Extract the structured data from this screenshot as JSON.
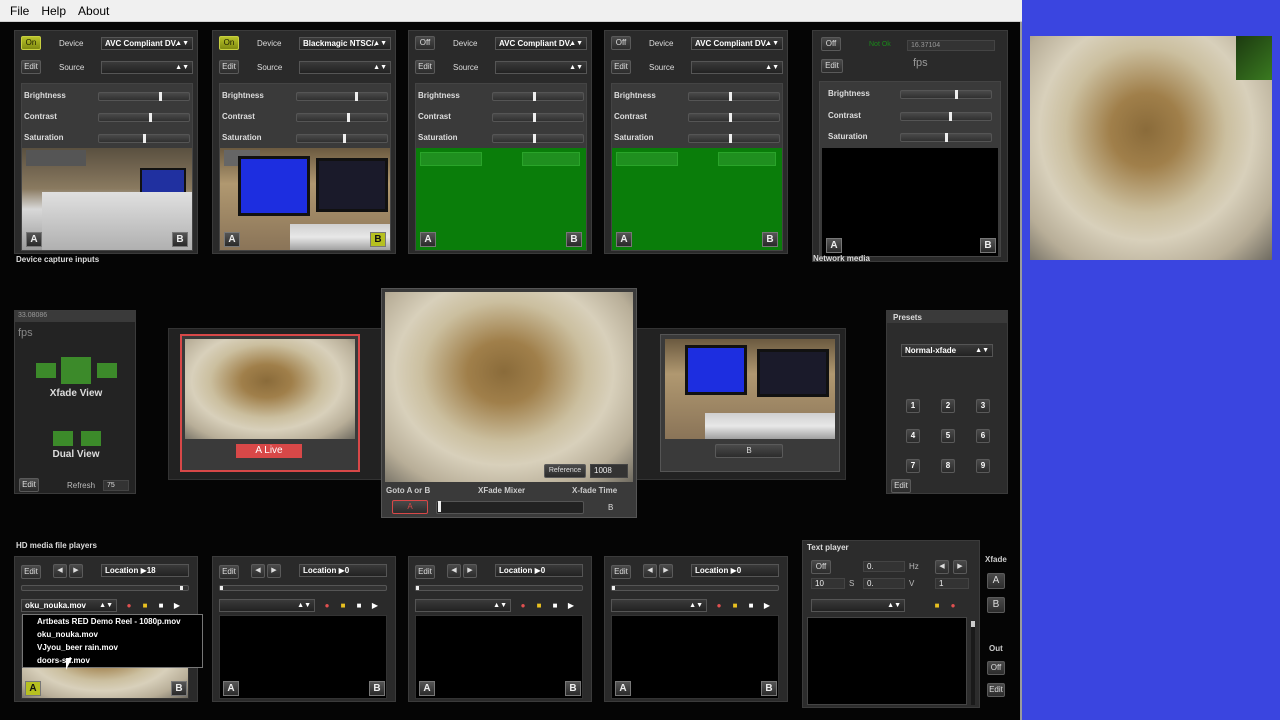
{
  "menu": {
    "file": "File",
    "help": "Help",
    "about": "About"
  },
  "labels": {
    "on": "On",
    "off": "Off",
    "edit": "Edit",
    "device": "Device",
    "source": "Source",
    "brightness": "Brightness",
    "contrast": "Contrast",
    "saturation": "Saturation",
    "a": "A",
    "b": "B",
    "fps": "fps"
  },
  "capture": {
    "section_label": "Device capture inputs",
    "channels": [
      {
        "state": "On",
        "device": "AVC Compliant DV.",
        "b_active": false
      },
      {
        "state": "On",
        "device": "Blackmagic NTSC/.",
        "b_active": true
      },
      {
        "state": "Off",
        "device": "AVC Compliant DV.",
        "b_active": false
      },
      {
        "state": "Off",
        "device": "AVC Compliant DV.",
        "b_active": false
      }
    ]
  },
  "network": {
    "section_label": "Network media",
    "state": "Off",
    "status": "Not Ok",
    "fps_value": "16.37104",
    "fps_label": "fps"
  },
  "xfade_panel": {
    "fps_value": "33.08086",
    "fps_label": "fps",
    "xfade_view": "Xfade View",
    "dual_view": "Dual View",
    "refresh_label": "Refresh",
    "refresh_value": "75"
  },
  "mixer": {
    "a_live": "A Live",
    "b_label": "B",
    "reference": "Reference",
    "time_value": "1008",
    "goto_label": "Goto A or B",
    "mixer_label": "XFade Mixer",
    "time_label": "X-fade Time",
    "position": 0.01
  },
  "presets": {
    "title": "Presets",
    "mode": "Normal-xfade",
    "buttons": [
      "1",
      "2",
      "3",
      "4",
      "5",
      "6",
      "7",
      "8",
      "9"
    ]
  },
  "media": {
    "section_label": "HD media file players",
    "players": [
      {
        "location": "Location",
        "location_value": "18",
        "file": "oku_nouka.mov"
      },
      {
        "location": "Location",
        "location_value": "0",
        "file": ""
      },
      {
        "location": "Location",
        "location_value": "0",
        "file": ""
      },
      {
        "location": "Location",
        "location_value": "0",
        "file": ""
      }
    ],
    "dropdown": [
      "Artbeats RED Demo Reel - 1080p.mov",
      "oku_nouka.mov",
      "VJyou_beer rain.mov",
      "doors-sd.mov"
    ]
  },
  "text_player": {
    "title": "Text player",
    "state": "Off",
    "hz_value": "0.",
    "hz_label": "Hz",
    "s_value": "10",
    "s_label": "S",
    "v_value": "0.",
    "v_label": "V",
    "v2_value": "1"
  },
  "xfade_side": {
    "title": "Xfade",
    "a": "A",
    "b": "B",
    "out_title": "Out",
    "out_state": "Off",
    "edit": "Edit"
  }
}
